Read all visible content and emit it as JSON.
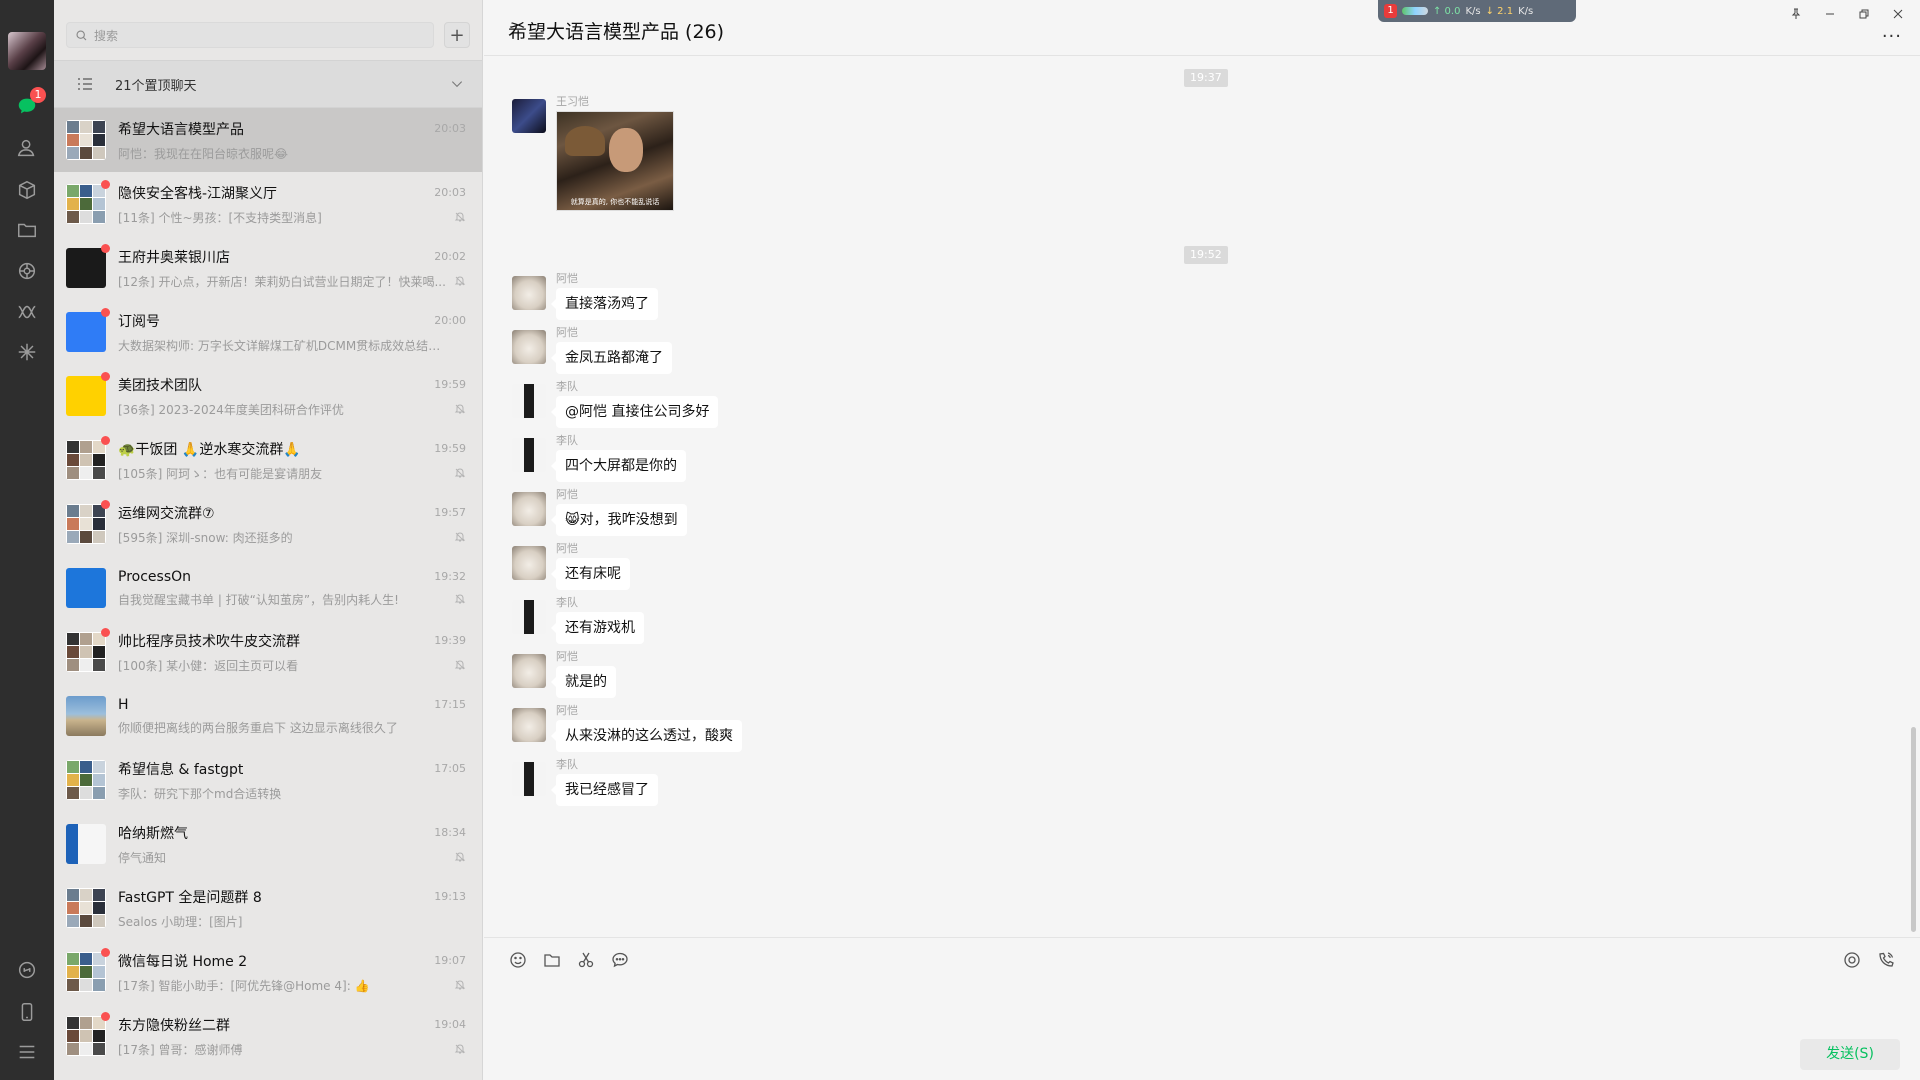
{
  "search": {
    "placeholder": "搜索"
  },
  "pinned_label": "21个置顶聊天",
  "rail": {
    "chat_badge": "1"
  },
  "conversations": [
    {
      "name": "希望大语言模型产品",
      "time": "20:03",
      "preview": "阿恺：我现在在阳台晾衣服呢😂",
      "selected": true,
      "dot": false,
      "muted": false,
      "avatar": "grid"
    },
    {
      "name": "隐侠安全客栈-江湖聚义厅",
      "time": "20:03",
      "preview": "[11条] 个性~男孩：[不支持类型消息]",
      "dot": true,
      "muted": true,
      "avatar": "grid"
    },
    {
      "name": "王府井奥莱银川店",
      "time": "20:02",
      "preview": "[12条] 开心点，开新店！茉莉奶白试营业日期定了！快莱喝...",
      "dot": true,
      "muted": true,
      "avatar": "outlets"
    },
    {
      "name": "订阅号",
      "time": "20:00",
      "preview": "大数据架构师: 万字长文详解煤工矿机DCMM贯标成效总结【...",
      "dot": true,
      "muted": false,
      "avatar": "subscribe"
    },
    {
      "name": "美团技术团队",
      "time": "19:59",
      "preview": "[36条] 2023-2024年度美团科研合作评优",
      "dot": true,
      "muted": true,
      "avatar": "meituan"
    },
    {
      "name": "🐢干饭团 🙏逆水寒交流群🙏",
      "time": "19:59",
      "preview": "[105条] 阿珂ゝ：也有可能是宴请朋友",
      "dot": true,
      "muted": true,
      "avatar": "grid"
    },
    {
      "name": "运维网交流群⑦",
      "time": "19:57",
      "preview": "[595条] 深圳-snow: 肉还挺多的",
      "dot": true,
      "muted": true,
      "avatar": "grid"
    },
    {
      "name": "ProcessOn",
      "time": "19:32",
      "preview": "自我觉醒宝藏书单 | 打破“认知茧房”，告别内耗人生!",
      "dot": false,
      "muted": true,
      "avatar": "processon"
    },
    {
      "name": "帅比程序员技术吹牛皮交流群",
      "time": "19:39",
      "preview": "[100条] 某小健：返回主页可以看",
      "dot": true,
      "muted": true,
      "avatar": "grid"
    },
    {
      "name": "H",
      "time": "17:15",
      "preview": "你顺便把离线的两台服务重启下 这边显示离线很久了",
      "dot": false,
      "muted": false,
      "avatar": "beach"
    },
    {
      "name": "希望信息 & fastgpt",
      "time": "17:05",
      "preview": "李队：研究下那个md合适转换",
      "dot": false,
      "muted": false,
      "avatar": "grid"
    },
    {
      "name": "哈纳斯燃气",
      "time": "18:34",
      "preview": "停气通知",
      "dot": false,
      "muted": true,
      "avatar": "hanas"
    },
    {
      "name": "FastGPT 全是问题群 8",
      "time": "19:13",
      "preview": "Sealos 小助理：[图片]",
      "dot": false,
      "muted": false,
      "avatar": "grid"
    },
    {
      "name": "微信每日说 Home 2",
      "time": "19:07",
      "preview": "[17条] 智能小助手：[阿优先锋@Home 4]: 👍",
      "dot": true,
      "muted": true,
      "avatar": "grid"
    },
    {
      "name": "东方隐侠粉丝二群",
      "time": "19:04",
      "preview": "[17条] 曾哥：感谢师傅",
      "dot": true,
      "muted": true,
      "avatar": "grid"
    }
  ],
  "chat": {
    "title": "希望大语言模型产品 (26)",
    "more": "···",
    "timestamps": [
      "19:37",
      "19:52"
    ],
    "image_message": {
      "sender": "王习恺",
      "caption": "就算是真的, 你也不能乱说话"
    },
    "messages": [
      {
        "sender": "阿恺",
        "text": "直接落汤鸡了",
        "avatar": "cat"
      },
      {
        "sender": "阿恺",
        "text": "金凤五路都淹了",
        "avatar": "cat"
      },
      {
        "sender": "李队",
        "text": "@阿恺 直接住公司多好",
        "avatar": "guitar"
      },
      {
        "sender": "李队",
        "text": "四个大屏都是你的",
        "avatar": "guitar"
      },
      {
        "sender": "阿恺",
        "text": "😸对，我咋没想到",
        "avatar": "cat"
      },
      {
        "sender": "阿恺",
        "text": "还有床呢",
        "avatar": "cat"
      },
      {
        "sender": "李队",
        "text": "还有游戏机",
        "avatar": "guitar"
      },
      {
        "sender": "阿恺",
        "text": "就是的",
        "avatar": "cat"
      },
      {
        "sender": "阿恺",
        "text": "从来没淋的这么透过，酸爽",
        "avatar": "cat"
      },
      {
        "sender": "李队",
        "text": "我已经感冒了",
        "avatar": "guitar"
      }
    ]
  },
  "netmon": {
    "badge": "1",
    "up": "↑ 0.0",
    "up_unit": "K/s",
    "down": "↓ 2.1",
    "down_unit": "K/s"
  },
  "composer": {
    "send_label": "发送(S)"
  },
  "colors": {
    "accent": "#07c160",
    "badge": "#fa5151",
    "rail": "#2e2e2e",
    "list_bg": "#e8e7e6",
    "chat_bg": "#f5f5f5"
  }
}
